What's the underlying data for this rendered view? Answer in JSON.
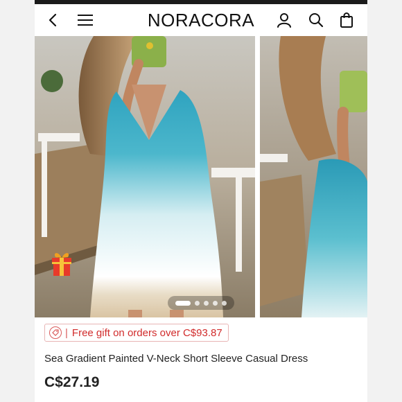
{
  "header": {
    "brand": "NORACORA",
    "back_icon": "chevron-left-icon",
    "menu_icon": "hamburger-menu-icon",
    "account_icon": "user-icon",
    "search_icon": "search-icon",
    "cart_icon": "shopping-bag-icon"
  },
  "gallery": {
    "slides": [
      "product-photo-1",
      "product-photo-2"
    ],
    "current_slide": 1,
    "total_dots": 5
  },
  "promo": {
    "text": "Free gift on orders over C$93.87",
    "accent_color": "#d12b2b"
  },
  "product": {
    "title": "Sea Gradient Painted V-Neck Short Sleeve Casual Dress",
    "price": "C$27.19"
  }
}
